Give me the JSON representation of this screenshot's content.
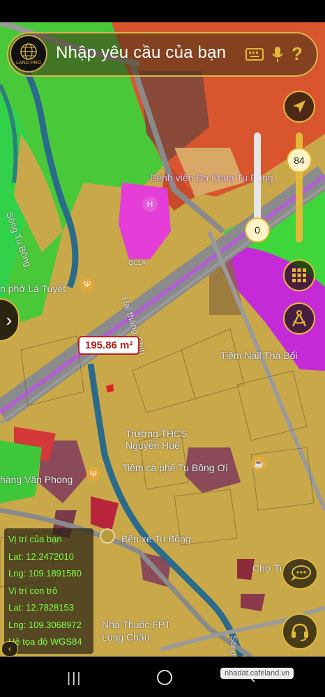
{
  "search": {
    "placeholder": "Nhập yêu cầu của bạn",
    "logo_text": "LAND PRO"
  },
  "sliders": {
    "left_value": "0",
    "right_value": "84"
  },
  "measure": {
    "area_label": "195.86 m²"
  },
  "map_labels": {
    "hospital": "Bệnh viện Đa Khoa Tu Bông",
    "cafe_la_tuyet": "n phở Lá Tuyết",
    "river": "Sông Tu Bông",
    "road": "Hai tháng Chín",
    "road_code": "QL1A",
    "nail": "Tiệm Nail Thà Bối",
    "school": "Trường THCS Nguyễn Huệ",
    "cafe_tu_bong": "Tiệm cà phê Tu Bông Ơi",
    "van_phong": "hàng Vân Phong",
    "bus": "Bến xe Tu Bông",
    "market": "Chợ Tu Bông",
    "pharmacy": "Nhà Thuốc FPT Long Châu",
    "river2": "Sông"
  },
  "info": {
    "your_position": "Vị trí của bạn",
    "lat1": "Lat: 12.2472010",
    "lng1": "Lng: 109.1891580",
    "pointer_position": "Vị trí con trỏ",
    "lat2": "Lat: 12.7828153",
    "lng2": "Lng: 109.3068972",
    "crs": "Hệ tọa độ WGS84"
  },
  "watermark": "nhadat.cafeland.vn",
  "colors": {
    "accent": "#e2b93b",
    "info_text": "#7dff4a",
    "measure_red": "#b41d1d"
  }
}
